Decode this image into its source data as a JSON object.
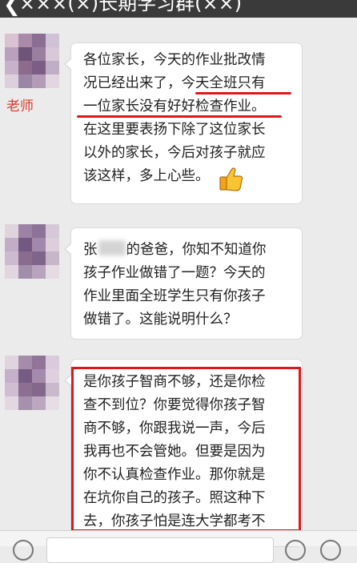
{
  "header": {
    "back_glyph": "❮",
    "title": "×××(×)长期学习群(××)"
  },
  "messages": [
    {
      "sender_label": "老师",
      "lines": [
        "各位家长，今天的作业批改情",
        "况已经出来了，今天全班只有",
        "一位家长没有好好检查作业。",
        "在这里要表扬下除了这位家长",
        "以外的家长，今后对孩子就应",
        "该这样，多上心些。"
      ],
      "emoji": "thumbs-up-icon"
    },
    {
      "line1_prefix": "张",
      "line1_suffix": "的爸爸，你知不知道你",
      "lines": [
        "孩子作业做错了一题？今天的",
        "作业里面全班学生只有你孩子",
        "做错了。这能说明什么？"
      ]
    },
    {
      "lines": [
        "是你孩子智商不够，还是你检",
        "查不到位？你要觉得你孩子智",
        "商不够，你跟我说一声，今后",
        "我再也不会管她。但要是因为",
        "你不认真检查作业。那你就是",
        "在坑你自己的孩子。照这种下",
        "去，你孩子怕是连大学都考不"
      ]
    }
  ],
  "colors": {
    "highlight_red": "#e0171a",
    "sender_red": "#e23a2e",
    "header_bg": "#3a3a3a",
    "chat_bg": "#ebebeb"
  }
}
